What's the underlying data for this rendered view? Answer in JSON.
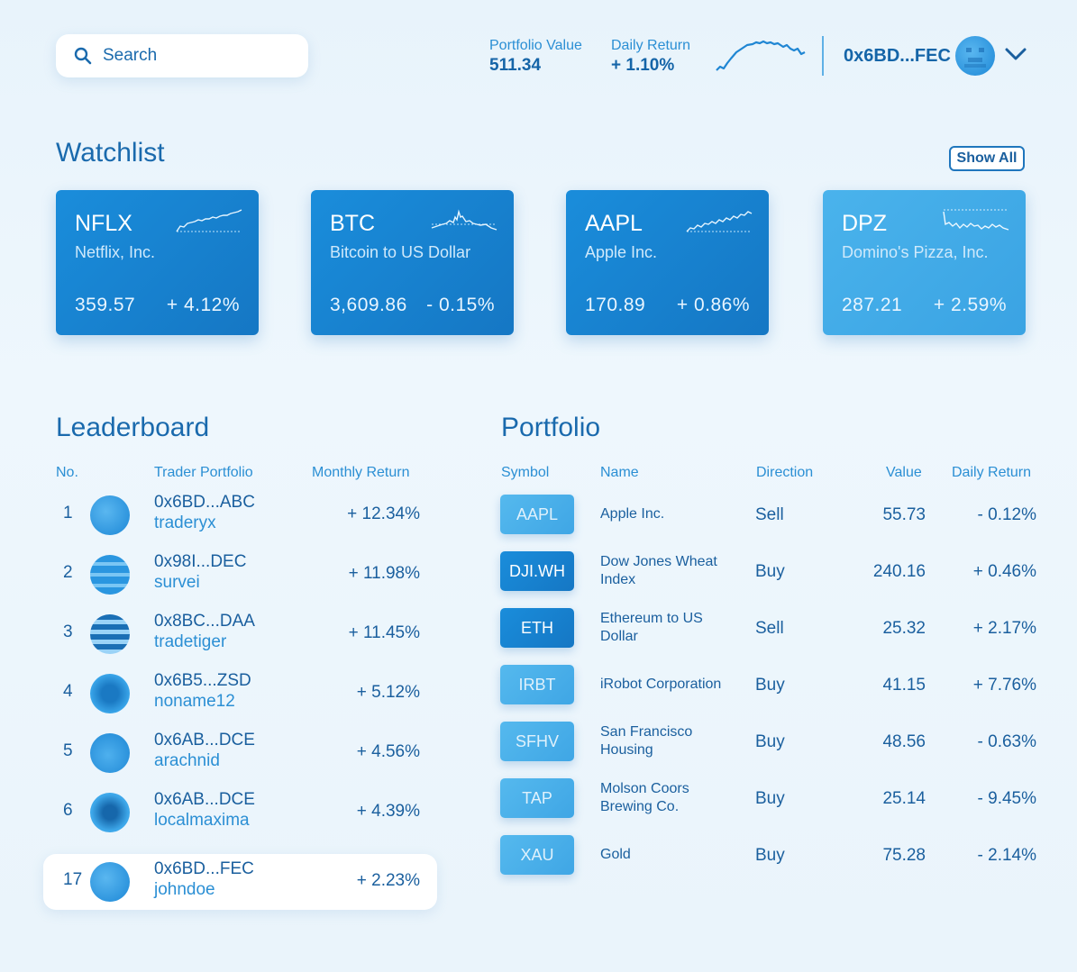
{
  "header": {
    "search": {
      "placeholder": "Search",
      "icon": "search-icon"
    },
    "portfolio_value": {
      "label": "Portfolio Value",
      "value": "511.34"
    },
    "daily_return": {
      "label": "Daily Return",
      "value": "+ 1.10%"
    },
    "account": {
      "address": "0x6BD...FEC"
    }
  },
  "watchlist": {
    "title": "Watchlist",
    "show_all_label": "Show All",
    "cards": [
      {
        "symbol": "NFLX",
        "name": "Netflix, Inc.",
        "price": "359.57",
        "change": "+ 4.12%"
      },
      {
        "symbol": "BTC",
        "name": "Bitcoin to US Dollar",
        "price": "3,609.86",
        "change": "- 0.15%"
      },
      {
        "symbol": "AAPL",
        "name": "Apple Inc.",
        "price": "170.89",
        "change": "+ 0.86%"
      },
      {
        "symbol": "DPZ",
        "name": "Domino's Pizza, Inc.",
        "price": "287.21",
        "change": "+ 2.59%"
      }
    ]
  },
  "leaderboard": {
    "title": "Leaderboard",
    "columns": [
      "No.",
      "Trader Portfolio",
      "Monthly Return"
    ],
    "rows": [
      {
        "rank": "1",
        "address": "0x6BD...ABC",
        "username": "traderyx",
        "return": "+ 12.34%"
      },
      {
        "rank": "2",
        "address": "0x98I...DEC",
        "username": "survei",
        "return": "+ 11.98%"
      },
      {
        "rank": "3",
        "address": "0x8BC...DAA",
        "username": "tradetiger",
        "return": "+ 11.45%"
      },
      {
        "rank": "4",
        "address": "0x6B5...ZSD",
        "username": "noname12",
        "return": "+ 5.12%"
      },
      {
        "rank": "5",
        "address": "0x6AB...DCE",
        "username": "arachnid",
        "return": "+ 4.56%"
      },
      {
        "rank": "6",
        "address": "0x6AB...DCE",
        "username": "localmaxima",
        "return": "+ 4.39%"
      },
      {
        "rank": "17",
        "address": "0x6BD...FEC",
        "username": "johndoe",
        "return": "+ 2.23%"
      }
    ]
  },
  "portfolio": {
    "title": "Portfolio",
    "columns": [
      "Symbol",
      "Name",
      "Direction",
      "Value",
      "Daily Return"
    ],
    "rows": [
      {
        "symbol": "AAPL",
        "name_l1": "Apple Inc.",
        "name_l2": "",
        "direction": "Sell",
        "value": "55.73",
        "daily_return": "- 0.12%"
      },
      {
        "symbol": "DJI.WH",
        "name_l1": "Dow Jones Wheat",
        "name_l2": "Index",
        "direction": "Buy",
        "value": "240.16",
        "daily_return": "+ 0.46%"
      },
      {
        "symbol": "ETH",
        "name_l1": "Ethereum to US",
        "name_l2": "Dollar",
        "direction": "Sell",
        "value": "25.32",
        "daily_return": "+ 2.17%"
      },
      {
        "symbol": "IRBT",
        "name_l1": "iRobot Corporation",
        "name_l2": "",
        "direction": "Buy",
        "value": "41.15",
        "daily_return": "+ 7.76%"
      },
      {
        "symbol": "SFHV",
        "name_l1": "San Francisco",
        "name_l2": "Housing",
        "direction": "Buy",
        "value": "48.56",
        "daily_return": "- 0.63%"
      },
      {
        "symbol": "TAP",
        "name_l1": "Molson Coors",
        "name_l2": "Brewing Co.",
        "direction": "Buy",
        "value": "25.14",
        "daily_return": "- 9.45%"
      },
      {
        "symbol": "XAU",
        "name_l1": "Gold",
        "name_l2": "",
        "direction": "Buy",
        "value": "75.28",
        "daily_return": "- 2.14%"
      }
    ]
  },
  "colors": {
    "accent": "#1a8ddb",
    "text": "#1a5f9e",
    "label": "#2b8fd4",
    "background": "#e8f3fb"
  }
}
